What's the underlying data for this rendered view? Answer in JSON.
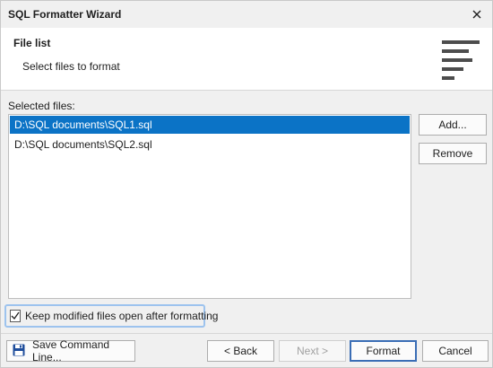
{
  "window": {
    "title": "SQL Formatter Wizard",
    "close_icon": "close-icon"
  },
  "header": {
    "title": "File list",
    "subtitle": "Select files to format",
    "icon": "format-lines-icon"
  },
  "files": {
    "label": "Selected files:",
    "items": [
      {
        "path": "D:\\SQL documents\\SQL1.sql",
        "selected": true
      },
      {
        "path": "D:\\SQL documents\\SQL2.sql",
        "selected": false
      }
    ]
  },
  "side_buttons": {
    "add_label": "Add...",
    "remove_label": "Remove"
  },
  "options": {
    "keep_open_label": "Keep modified files open after formatting",
    "keep_open_checked": true
  },
  "footer": {
    "save_label": "Save Command Line...",
    "save_icon": "floppy-disk-icon",
    "back_label": "< Back",
    "next_label": "Next >",
    "next_enabled": false,
    "format_label": "Format",
    "cancel_label": "Cancel"
  },
  "colors": {
    "selection": "#0b73c6",
    "focus_ring": "#9dc3ee",
    "icon_blue": "#1f4e9c"
  }
}
